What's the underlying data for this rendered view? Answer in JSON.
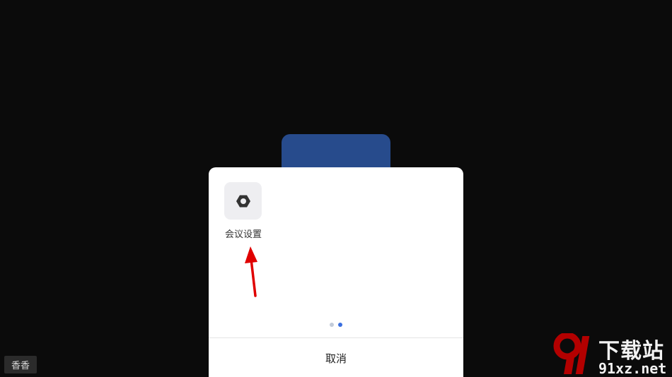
{
  "sheet": {
    "actions": [
      {
        "label": "会议设置",
        "icon": "hex-gear-icon"
      }
    ],
    "pager": {
      "count": 2,
      "active_index": 1
    },
    "cancel_label": "取消"
  },
  "participant": {
    "name": "香香"
  },
  "watermark": {
    "text_cn": "下载站",
    "url": "91xz.net",
    "logo": "91"
  },
  "colors": {
    "background": "#0b0b0b",
    "video_tile": "#274b8c",
    "sheet": "#ffffff",
    "accent": "#3a6fe0",
    "annotation_arrow": "#e00000"
  }
}
